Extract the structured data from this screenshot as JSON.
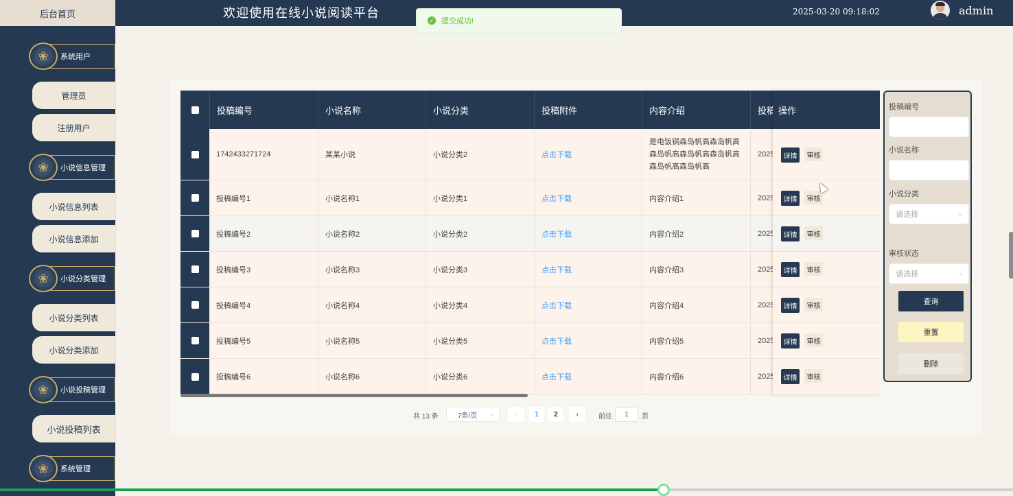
{
  "header": {
    "home_tab": "后台首页",
    "title": "欢迎使用在线小说阅读平台",
    "datetime": "2025-03-20 09:18:02",
    "username": "admin"
  },
  "toast": {
    "message": "提交成功!"
  },
  "sidebar": {
    "groups": [
      {
        "label": "系统用户",
        "items": [
          "管理员",
          "注册用户"
        ]
      },
      {
        "label": "小说信息管理",
        "items": [
          "小说信息列表",
          "小说信息添加"
        ]
      },
      {
        "label": "小说分类管理",
        "items": [
          "小说分类列表",
          "小说分类添加"
        ]
      },
      {
        "label": "小说投稿管理",
        "items": [
          "小说投稿列表"
        ]
      },
      {
        "label": "系统管理",
        "items": []
      }
    ]
  },
  "table": {
    "columns": [
      "投稿编号",
      "小说名称",
      "小说分类",
      "投稿附件",
      "内容介绍",
      "投稿"
    ],
    "op_column": "操作",
    "rows": [
      {
        "id": "1742433271724",
        "name": "某某小说",
        "category": "小说分类2",
        "attachment": "点击下载",
        "intro": "是电饭锅森岛帆高森岛帆高森岛帆高森岛帆高森岛帆高森岛帆高森岛帆高",
        "date": "2025"
      },
      {
        "id": "投稿编号1",
        "name": "小说名称1",
        "category": "小说分类1",
        "attachment": "点击下载",
        "intro": "内容介绍1",
        "date": "2025"
      },
      {
        "id": "投稿编号2",
        "name": "小说名称2",
        "category": "小说分类2",
        "attachment": "点击下载",
        "intro": "内容介绍2",
        "date": "2025"
      },
      {
        "id": "投稿编号3",
        "name": "小说名称3",
        "category": "小说分类3",
        "attachment": "点击下载",
        "intro": "内容介绍3",
        "date": "2025"
      },
      {
        "id": "投稿编号4",
        "name": "小说名称4",
        "category": "小说分类4",
        "attachment": "点击下载",
        "intro": "内容介绍4",
        "date": "2025"
      },
      {
        "id": "投稿编号5",
        "name": "小说名称5",
        "category": "小说分类5",
        "attachment": "点击下载",
        "intro": "内容介绍5",
        "date": "2025"
      },
      {
        "id": "投稿编号6",
        "name": "小说名称6",
        "category": "小说分类6",
        "attachment": "点击下载",
        "intro": "内容介绍6",
        "date": "2025"
      }
    ],
    "detail_label": "详情",
    "review_label": "审核"
  },
  "pagination": {
    "total": "共 13 条",
    "page_size": "7条/页",
    "pages": [
      "1",
      "2"
    ],
    "current_page": "1",
    "goto_label": "前往",
    "goto_value": "1",
    "page_unit": "页"
  },
  "search": {
    "id_label": "投稿编号",
    "name_label": "小说名称",
    "category_label": "小说分类",
    "category_placeholder": "请选择",
    "status_label": "审核状态",
    "status_placeholder": "请选择",
    "query_label": "查询",
    "reset_label": "重置",
    "delete_label": "删除"
  },
  "video_progress": 0.655,
  "colors": {
    "primary": "#253a52",
    "accent_beige": "#e7ddd1",
    "link": "#409eff",
    "success": "#67c23a"
  }
}
